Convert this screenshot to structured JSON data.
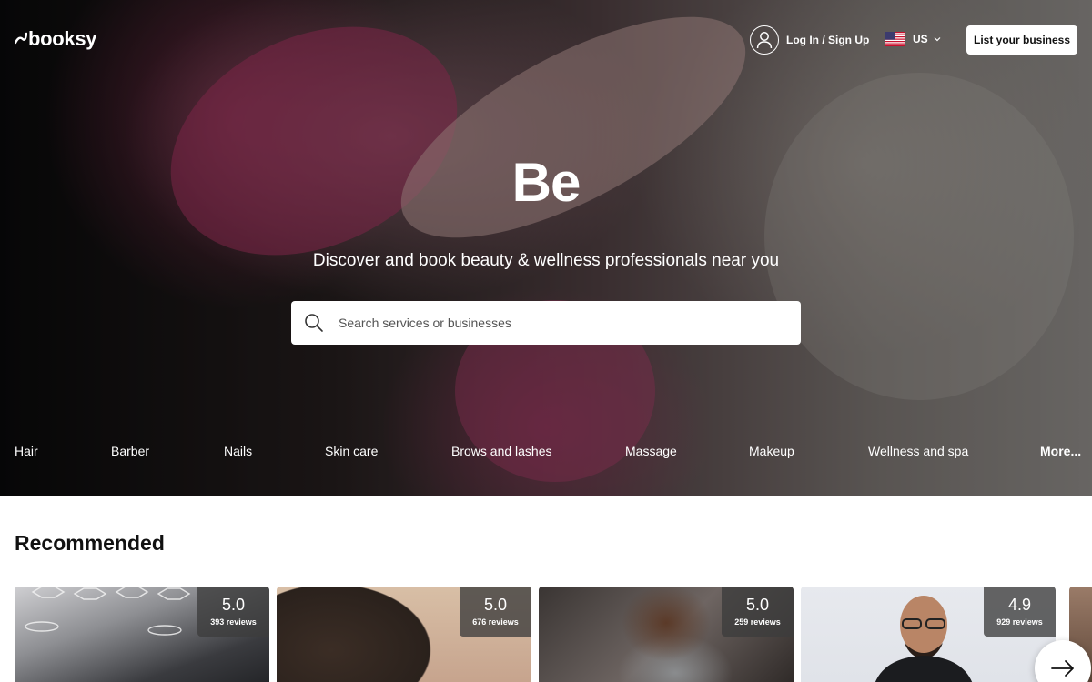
{
  "header": {
    "logo_text": "booksy",
    "login_label": "Log In / Sign Up",
    "locale_label": "US",
    "list_business_label": "List your business"
  },
  "hero": {
    "title": "Be",
    "subtitle": "Discover and book beauty & wellness professionals near you",
    "search": {
      "placeholder": "Search services or businesses",
      "value": ""
    }
  },
  "categories": [
    "Hair",
    "Barber",
    "Nails",
    "Skin care",
    "Brows and lashes",
    "Massage",
    "Makeup",
    "Wellness and spa",
    "More..."
  ],
  "recommended": {
    "title": "Recommended",
    "cards": [
      {
        "score": "5.0",
        "reviews": "393 reviews"
      },
      {
        "score": "5.0",
        "reviews": "676 reviews"
      },
      {
        "score": "5.0",
        "reviews": "259 reviews"
      },
      {
        "score": "4.9",
        "reviews": "929 reviews"
      }
    ]
  },
  "icons": {
    "user": "user-icon",
    "flag": "us-flag-icon",
    "chevron": "chevron-down-icon",
    "search": "search-icon",
    "next": "arrow-right-icon"
  },
  "colors": {
    "primary_text": "#111111",
    "white": "#ffffff",
    "rating_badge": "#3c3c3c"
  }
}
